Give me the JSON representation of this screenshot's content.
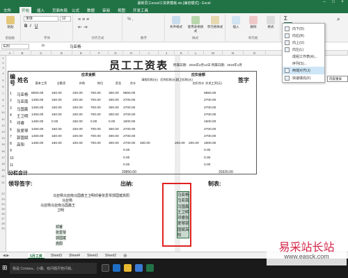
{
  "window": {
    "title": "最新员工excel工资表模板.xls [兼容模式] - Excel",
    "min_icon": "minimize-icon",
    "max_icon": "maximize-icon",
    "close_icon": "close-icon"
  },
  "ribbon_tabs": [
    "文件",
    "开始",
    "插入",
    "页面布局",
    "公式",
    "数据",
    "审阅",
    "视图",
    "开发工具"
  ],
  "ribbon": {
    "font_name": "宋体",
    "font_size": "12",
    "groups": [
      "剪贴板",
      "字体",
      "对齐方式",
      "数字",
      "样式",
      "单元格",
      "编辑"
    ],
    "buttons": [
      "粘贴",
      "条件格式",
      "套用表格格式",
      "单元格样式",
      "插入",
      "删除",
      "格式"
    ]
  },
  "dropdown": {
    "items": [
      "向下(D)",
      "向右(R)",
      "向上(U)",
      "向左(L)",
      "成组工作表(A)...",
      "序列(S)...",
      "两端对齐(J)",
      "快速填充(F)"
    ],
    "highlighted_index": 6,
    "tooltip": "内容重排"
  },
  "formula_bar": {
    "name_box": "E20",
    "fx": "fx",
    "value": "马亚杨"
  },
  "columns": [
    "A",
    "B",
    "C",
    "D",
    "E",
    "F",
    "G",
    "H",
    "I",
    "J",
    "K",
    "L",
    "M",
    "N",
    "O",
    "P"
  ],
  "rows": [
    "1",
    "2",
    "3",
    "4",
    "5",
    "6",
    "7",
    "8",
    "9",
    "10",
    "11",
    "12",
    "13",
    "14",
    "15",
    "16",
    "17",
    "18",
    "19",
    "20",
    "21",
    "22",
    "23",
    "24",
    "25",
    "26",
    "27",
    "28",
    "29"
  ],
  "sheet": {
    "title": "员工工资表",
    "period": "所属日期：2015年2月12日  所属日期：2015年1月",
    "hdr_num": "编号",
    "hdr_name": "姓名",
    "hdr_sign": "签字",
    "group_yf": "应发金额",
    "group_dk": "应扣金额",
    "sub_headers": [
      "基本工资",
      "全勤奖",
      "补助",
      "岗位",
      "奖金",
      "合计",
      "请假扣款(元)",
      "迟到扣款(元)",
      "国卫扣款(元)",
      "应扣合计",
      "实发工资(元)"
    ],
    "employees": [
      {
        "no": "1",
        "name": "马亚杨",
        "v": [
          "8000.00",
          "150.00",
          "100.00",
          "700.00",
          "300.00",
          "9850.00",
          "",
          "",
          "",
          "",
          "9850.00"
        ]
      },
      {
        "no": "2",
        "name": "马亚南",
        "v": [
          "1450.00",
          "150.00",
          "100.00",
          "700.00",
          "300.00",
          "2700.00",
          "",
          "",
          "",
          "",
          "2700.00"
        ]
      },
      {
        "no": "3",
        "name": "马国鑫",
        "v": [
          "1450.00",
          "150.00",
          "100.00",
          "700.00",
          "300.00",
          "2700.00",
          "",
          "",
          "",
          "",
          "2700.00"
        ]
      },
      {
        "no": "4",
        "name": "王卫明",
        "v": [
          "1450.00",
          "150.00",
          "100.00",
          "700.00",
          "300.00",
          "2700.00",
          "",
          "",
          "",
          "",
          "2700.00"
        ]
      },
      {
        "no": "5",
        "name": "邓睿",
        "v": [
          "1450.00",
          "0.00",
          "150.00",
          "0.00",
          "0.00",
          "1600.00",
          "",
          "",
          "",
          "",
          "1600.00"
        ]
      },
      {
        "no": "6",
        "name": "张爱琴",
        "v": [
          "1450.00",
          "150.00",
          "100.00",
          "700.00",
          "300.00",
          "2700.00",
          "",
          "",
          "",
          "",
          "2700.00"
        ]
      },
      {
        "no": "7",
        "name": "郭国斌",
        "v": [
          "1450.00",
          "150.00",
          "100.00",
          "700.00",
          "300.00",
          "2700.00",
          "",
          "",
          "",
          "",
          "2700.00"
        ]
      },
      {
        "no": "8",
        "name": "高阳",
        "v": [
          "1450.00",
          "150.00",
          "100.00",
          "700.00",
          "300.00",
          "2700.00",
          "330.00",
          "",
          "200.00",
          "200.00",
          "1800.00"
        ]
      },
      {
        "no": "9",
        "name": "",
        "v": [
          "",
          "",
          "",
          "",
          "",
          "0.00",
          "",
          "",
          "",
          "",
          "0.00"
        ]
      },
      {
        "no": "10",
        "name": "",
        "v": [
          "",
          "",
          "",
          "",
          "",
          "0.00",
          "",
          "",
          "",
          "",
          "0.00"
        ]
      },
      {
        "no": "11",
        "name": "",
        "v": [
          "",
          "",
          "",
          "",
          "",
          "0.00",
          "",
          "",
          "",
          "",
          "0.00"
        ]
      }
    ],
    "subtotal_label": "分栏合计",
    "subtotal_total": "20850.00",
    "subtotal_net": "20320.00",
    "sign_label": "领导签字:",
    "cashier_label": "出纳:",
    "maker_label": "制表:",
    "merged_line1": "马亚杨马亚南马国鑫王卫明邓睿张爱琴郭国斌高阳",
    "merged_line2": "马亚杨",
    "merged_line3": "马亚杨马亚南马国鑫王",
    "merged_line4": "卫明",
    "col_names": [
      "邓睿",
      "张爱琴",
      "郭国斌",
      "高阳"
    ],
    "selected_text": [
      "马亚杨",
      "马亚南",
      "马国鑫",
      "王卫明",
      "邓睿张",
      "爱琴郭",
      "国斌高",
      "阳"
    ]
  },
  "sheet_tabs": [
    "5月工资",
    "Sheet3",
    "Sheet4",
    "Sheet1",
    "Sheet2"
  ],
  "active_sheet_index": 0,
  "taskbar": {
    "search_placeholder": "我是 Cortana，小娜。有问题尽管问我。"
  },
  "watermark": {
    "line1": "易采站长站",
    "line2": "www.easck.com"
  },
  "colors": {
    "excel_green": "#217346",
    "highlight_red": "#e02020"
  }
}
